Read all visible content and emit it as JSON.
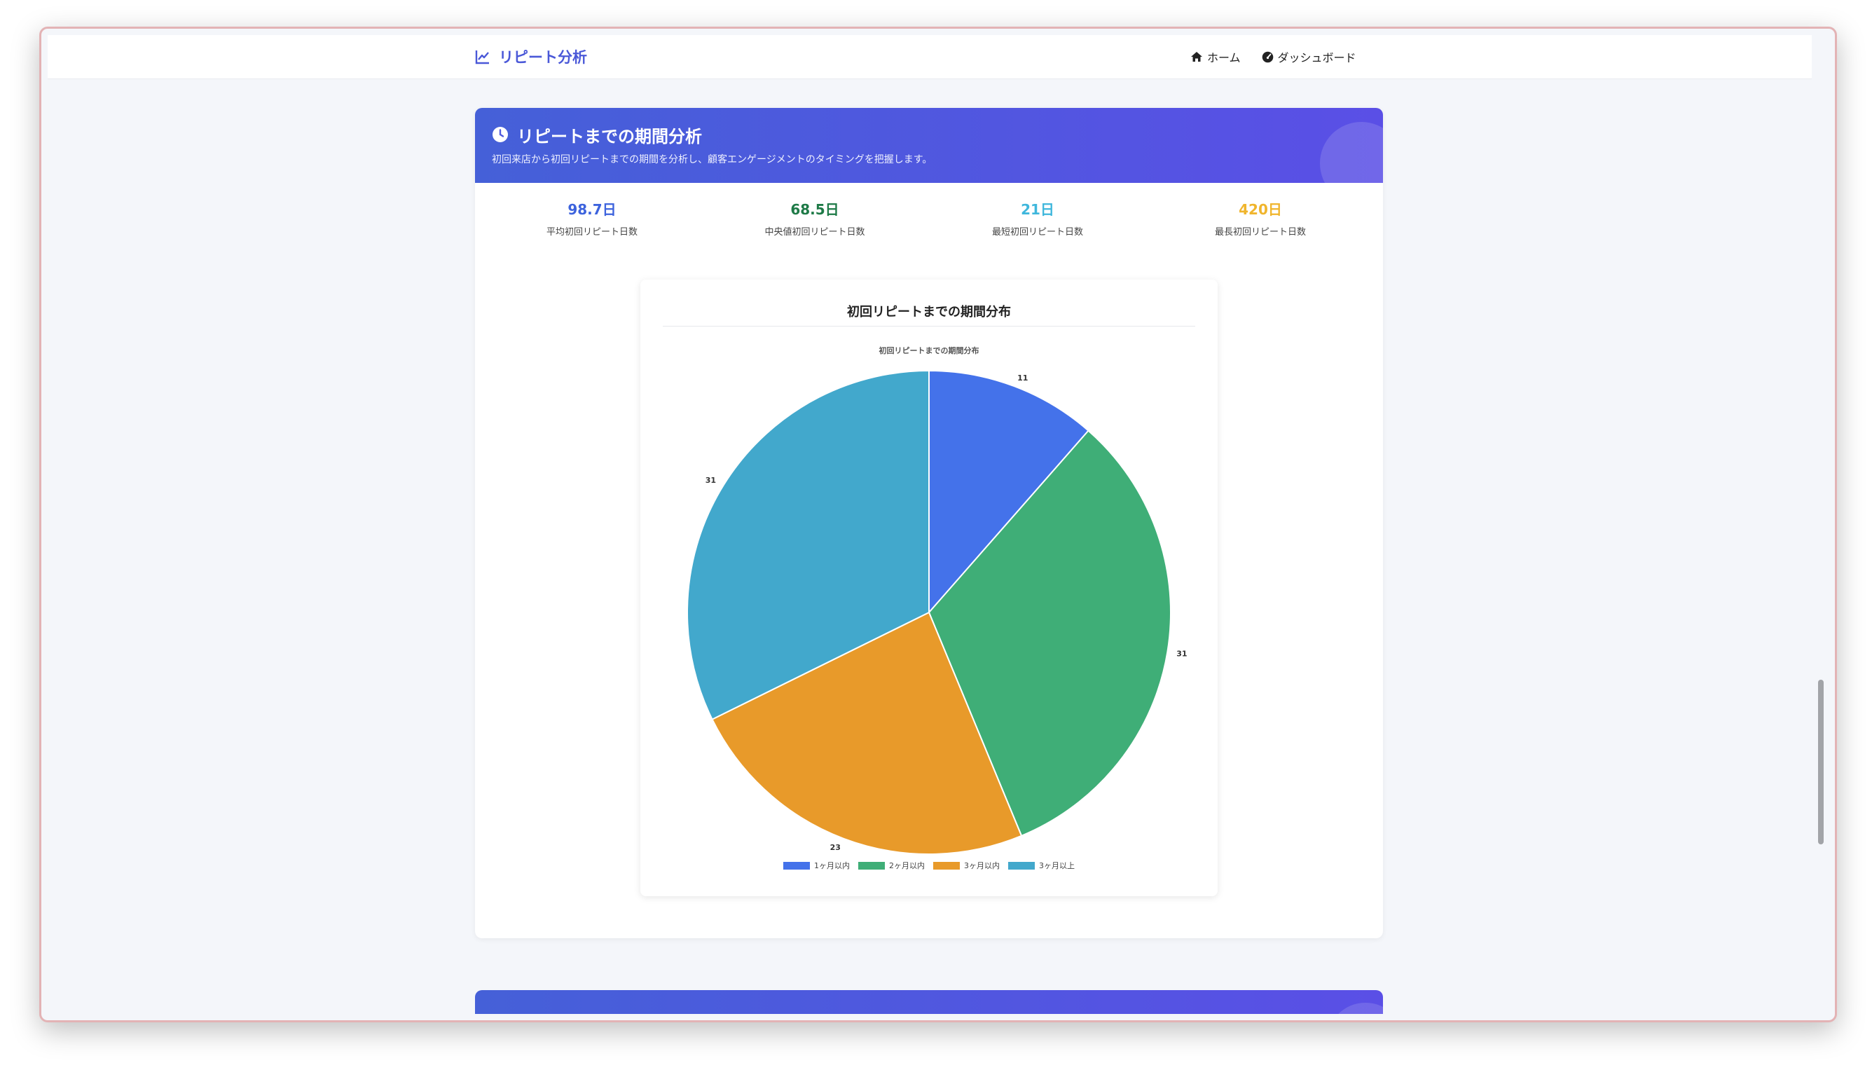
{
  "navbar": {
    "brand": "リピート分析",
    "links": [
      {
        "label": "ホーム",
        "icon": "home-icon"
      },
      {
        "label": "ダッシュボード",
        "icon": "dashboard-gauge-icon"
      }
    ]
  },
  "section": {
    "icon": "clock-icon",
    "title": "リピートまでの期間分析",
    "subtitle": "初回来店から初回リピートまでの期間を分析し、顧客エンゲージメントのタイミングを把握します。"
  },
  "stats": [
    {
      "value": "98.7日",
      "label": "平均初回リピート日数",
      "color": "#3d63dd"
    },
    {
      "value": "68.5日",
      "label": "中央値初回リピート日数",
      "color": "#1e7a47"
    },
    {
      "value": "21日",
      "label": "最短初回リピート日数",
      "color": "#3fb7dc"
    },
    {
      "value": "420日",
      "label": "最長初回リピート日数",
      "color": "#f0b52d"
    }
  ],
  "chart_card": {
    "title": "初回リピートまでの期間分布"
  },
  "chart_data": {
    "type": "pie",
    "title": "初回リピートまでの期間分布",
    "categories": [
      "1ヶ月以内",
      "2ヶ月以内",
      "3ヶ月以内",
      "3ヶ月以上"
    ],
    "values": [
      11,
      31,
      23,
      31
    ],
    "colors": [
      "#4472ea",
      "#3fae77",
      "#e89a2a",
      "#42a8cc"
    ],
    "legend_position": "bottom",
    "data_labels": true
  }
}
